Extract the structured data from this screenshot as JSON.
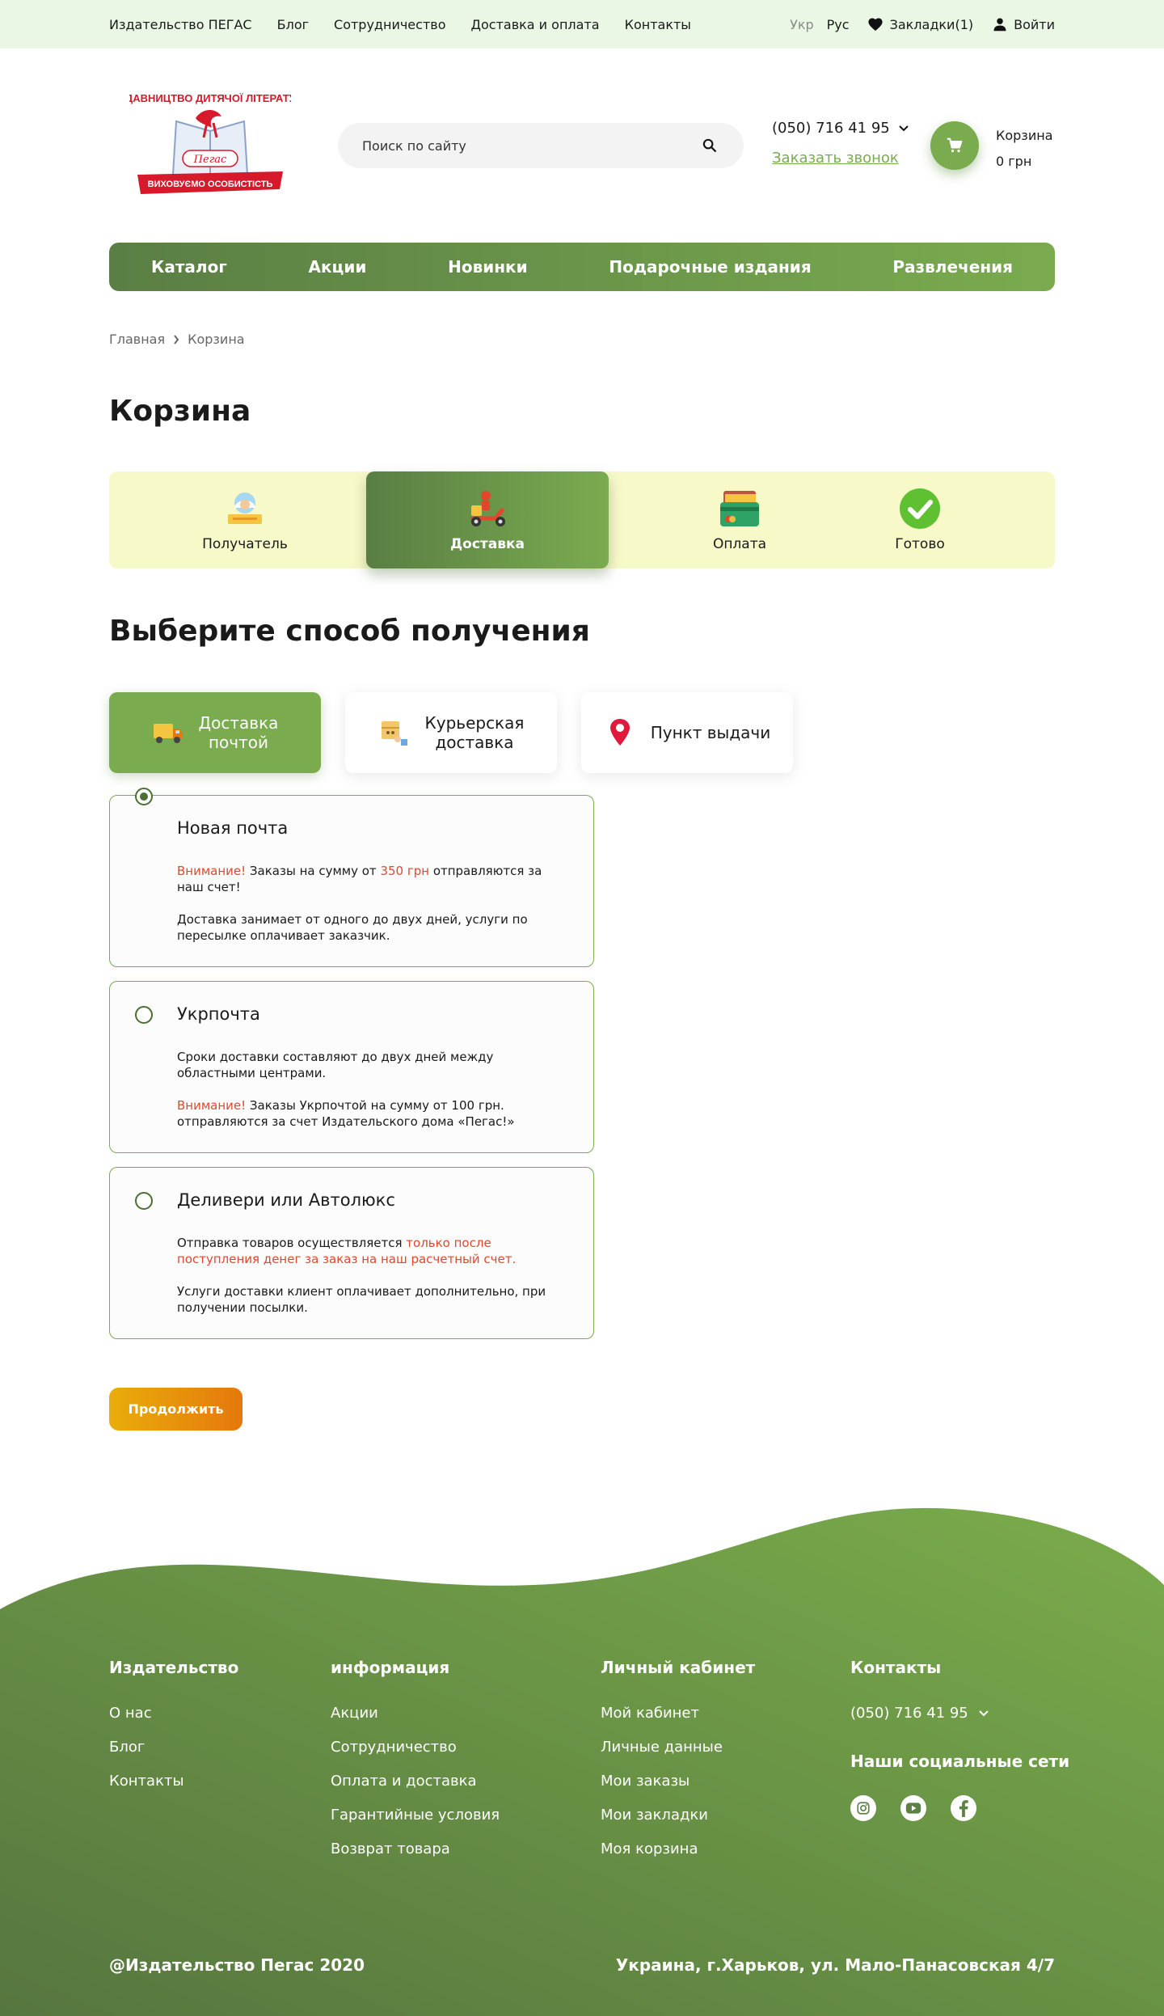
{
  "topbar": {
    "links": [
      "Издательство ПЕГАС",
      "Блог",
      "Сотрудничество",
      "Доставка и оплата",
      "Контакты"
    ],
    "lang_ukr": "Укр",
    "lang_rus": "Рус",
    "bookmarks": "Закладки(1)",
    "login": "Войти"
  },
  "header": {
    "logo_text_top": "ВИДАВНИЦТВО ДИТЯЧОЇ ЛІТЕРАТУРИ",
    "logo_brand": "Пегас",
    "logo_text_bottom": "ВИХОВУЄМО ОСОБИСТІСТЬ",
    "search_placeholder": "Поиск по сайту",
    "phone": "(050) 716 41 95",
    "callback": "Заказать звонок",
    "cart_label": "Корзина",
    "cart_total": "0 грн"
  },
  "nav": {
    "items": [
      "Каталог",
      "Акции",
      "Новинки",
      "Подарочные издания",
      "Развлечения"
    ]
  },
  "breadcrumb": {
    "home": "Главная",
    "current": "Корзина"
  },
  "page": {
    "title": "Корзина",
    "subtitle": "Выберите способ получения"
  },
  "steps": [
    {
      "label": "Получатель",
      "icon": "recipient-icon"
    },
    {
      "label": "Доставка",
      "icon": "courier-scooter-icon",
      "active": true
    },
    {
      "label": "Оплата",
      "icon": "wallet-card-icon"
    },
    {
      "label": "Готово",
      "icon": "check-icon"
    }
  ],
  "methods": [
    {
      "label_line1": "Доставка",
      "label_line2": "почтой",
      "icon": "truck-icon",
      "active": true
    },
    {
      "label_line1": "Курьерская",
      "label_line2": "доставка",
      "icon": "courier-box-icon"
    },
    {
      "label_line1": "Пункт выдачи",
      "icon": "location-pin-icon"
    }
  ],
  "options": [
    {
      "name": "Новая почта",
      "checked": true,
      "p1_red": "Внимание!",
      "p1_a": " Заказы на сумму от ",
      "p1_red2": "350 грн",
      "p1_b": " отправляются за наш счет!",
      "p2": "Доставка занимает от одного до двух дней, услуги по пересылке оплачивает заказчик."
    },
    {
      "name": "Укрпочта",
      "checked": false,
      "p1": "Сроки доставки составляют до двух дней между областными центрами.",
      "p2_red": "Внимание!",
      "p2_b": " Заказы Укрпочтой на сумму от 100 грн. отправляются за счет Издательского дома «Пегас!»"
    },
    {
      "name": "Деливери или Автолюкс",
      "checked": false,
      "p1_a": "Отправка товаров осуществляется ",
      "p1_red": "только после поступления денег за заказ на наш расчетный счет.",
      "p2": "Услуги доставки клиент оплачивает дополнительно, при получении посылки."
    }
  ],
  "continue_button": "Продолжить",
  "footer": {
    "col1": {
      "title": "Издательство",
      "links": [
        "О нас",
        "Блог",
        "Контакты"
      ]
    },
    "col2": {
      "title": "информация",
      "links": [
        "Акции",
        "Сотрудничество",
        "Оплата и доставка",
        "Гарантийные условия",
        "Возврат товара"
      ]
    },
    "col3": {
      "title": "Личный кабинет",
      "links": [
        "Мой кабинет",
        "Личные данные",
        "Мои заказы",
        "Мои закладки",
        "Моя корзина"
      ]
    },
    "col4": {
      "title": "Контакты",
      "phone": "(050) 716 41 95"
    },
    "social_title": "Наши социальные сети",
    "socials": [
      "instagram-icon",
      "youtube-icon",
      "facebook-icon"
    ],
    "copyright": "@Издательство Пегас 2020",
    "address": "Украина,  г.Харьков, ул. Мало-Панасовская 4/7"
  },
  "colors": {
    "green": "#7aab4f",
    "green_dark": "#5a7e44",
    "topbar_bg": "#ebf7e5",
    "steps_bg": "#f7f9c9",
    "warning_red": "#e2472c",
    "button_orange": "#e9ad0a"
  }
}
